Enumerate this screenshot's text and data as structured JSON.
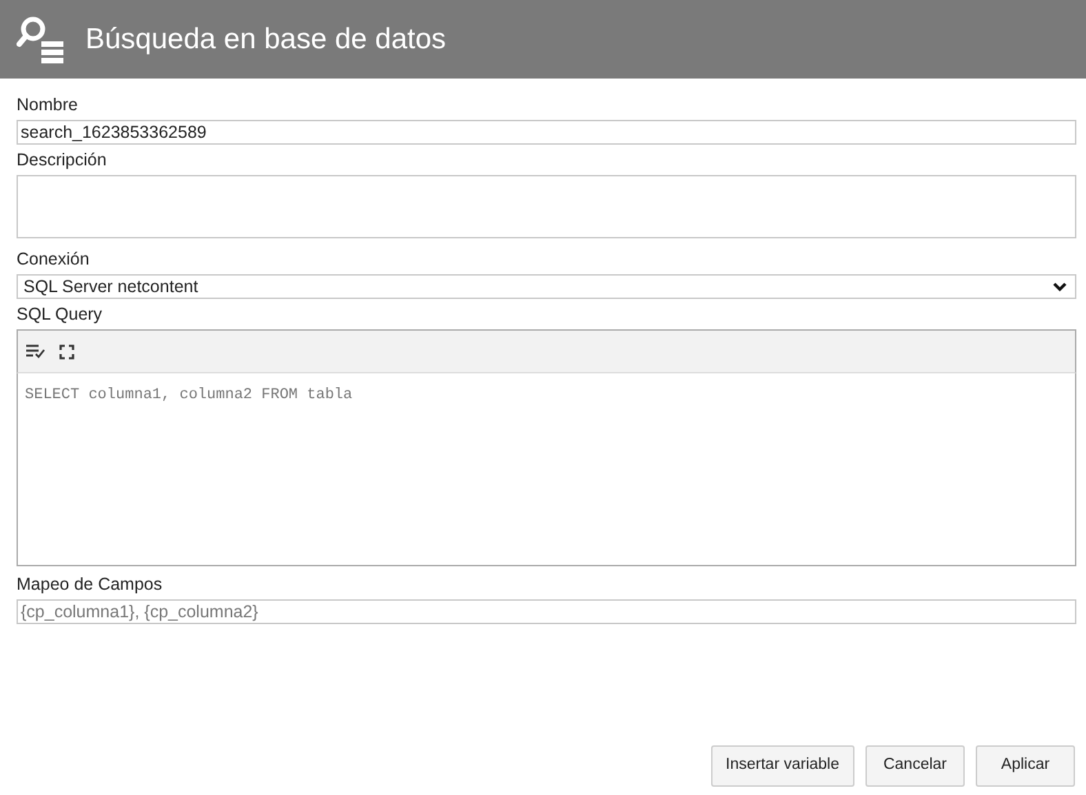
{
  "window": {
    "title": "Búsqueda en base de datos"
  },
  "fields": [
    {
      "kind": "text",
      "label": "Nombre",
      "value": "search_1623853362589"
    },
    {
      "kind": "textarea",
      "label": "Descripción"
    },
    {
      "kind": "select",
      "label": "Conexión",
      "value": "SQL Server netcontent"
    },
    {
      "kind": "code",
      "label": "SQL Query",
      "placeholder": "SELECT columna1, columna2 FROM tabla"
    },
    {
      "kind": "text",
      "label": "Mapeo de Campos",
      "placeholder": "{cp_columna1}, {cp_columna2}"
    }
  ],
  "buttons": [
    "Insertar variable",
    "Cancelar",
    "Aplicar"
  ]
}
